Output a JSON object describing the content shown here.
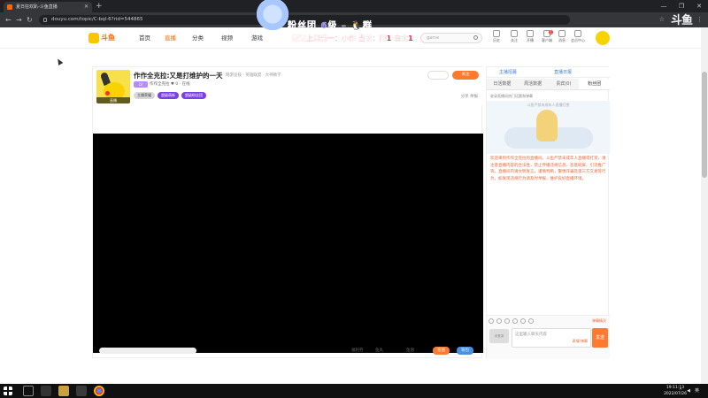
{
  "browser": {
    "tab_title": "夏日狂欢趴-斗鱼直播",
    "url": "douyu.com/topic/C-bql-6?rid=544865",
    "new_tab": "+",
    "window_controls": [
      "—",
      "❐",
      "✕"
    ]
  },
  "overlay": {
    "line1": "粉丝团 6级 – 🐧群",
    "line2": "感谢上周榜一：小作 当前：网1 白金1"
  },
  "site": {
    "logo": "斗鱼",
    "nav": [
      "首页",
      "直播",
      "分类",
      "视频",
      "游戏"
    ],
    "search_placeholder": "game",
    "header_icons": [
      {
        "label": "历史",
        "name": "history-icon"
      },
      {
        "label": "关注",
        "name": "follow-icon"
      },
      {
        "label": "开播",
        "name": "broadcast-icon"
      },
      {
        "label": "客户端",
        "name": "client-icon",
        "badge": "1"
      },
      {
        "label": "消息",
        "name": "message-icon"
      },
      {
        "label": "会员中心",
        "name": "member-icon"
      }
    ]
  },
  "room": {
    "title": "作作全克拉:又是打维护的一天",
    "category": "网游竞技 · 英雄联盟 · 大神教学",
    "level": "LV",
    "anchor": "作作全克拉  ♥ 0  · 在线",
    "avatar_tag": "直播",
    "follow_label": "关注",
    "tags": [
      "主播荣耀",
      "超级萌新",
      "超级粉丝团"
    ],
    "head_right": "分享   举报",
    "bottom_left": "",
    "bottom_items": [
      "福利券",
      "鱼丸",
      "鱼翅"
    ],
    "bottom_buttons": [
      "充值",
      "背包"
    ]
  },
  "chat": {
    "top_items": [
      "主播招募",
      "直播日报"
    ],
    "tabs": [
      "日活数据",
      "周活数据",
      "贵宾(0)",
      "粉丝团"
    ],
    "notice": "收录直播间热门话题和弹幕",
    "illustration_caption": "斗鱼严禁未成年人直播打赏",
    "system_message": "欢迎来到作作全克拉的直播间。斗鱼严禁未成年人直播或打赏，请注意直播内容的合法性，禁止传播违规信息、恶意刷屏、引流推广等。直播间内请文明发言，谨慎判断，警惕诈骗及第三方交易等行为，如发现违规行为请及时举报，维护良好直播环境。",
    "hint": "弹幕精灵",
    "avatar_text": "未登录",
    "input_placeholder": "这里输入聊天内容",
    "input_sub": "表情/弹幕",
    "send_label": "发送"
  },
  "taskbar": {
    "clock_time": "19:11:13",
    "clock_date": "2022/07/26",
    "tray": [
      "^",
      "◀",
      "英"
    ]
  },
  "corner_logo": "斗鱼"
}
